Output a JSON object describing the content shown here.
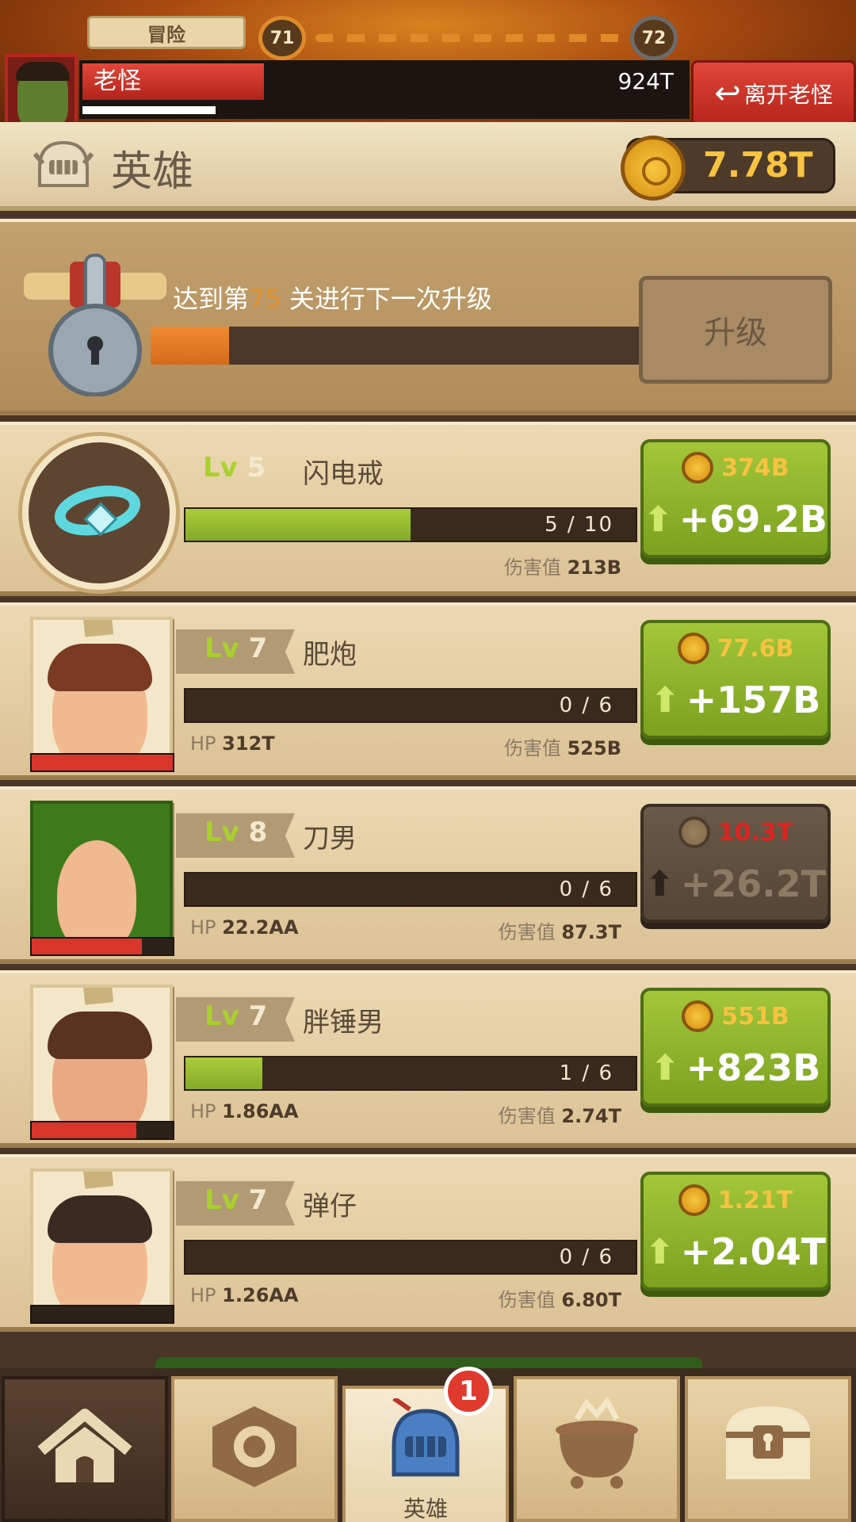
{
  "header": {
    "mode_label": "冒险",
    "current_stage": "71",
    "next_stage": "72",
    "boss_name": "老怪",
    "boss_hp": "924T",
    "boss_hp_fraction": 0.3,
    "boss_timer_fraction": 0.22,
    "leave_boss_label": "离开老怪"
  },
  "heroes_header": {
    "title": "英雄",
    "gold": "7.78T"
  },
  "upgrade": {
    "text_prefix": "达到第",
    "stage": "75",
    "text_suffix": " 关进行下一次升级",
    "progress": 0.16,
    "button_label": "升级"
  },
  "items": [
    {
      "kind": "artifact",
      "level_prefix": "Lv",
      "level": "5",
      "name": "闪电戒",
      "progress_text": "5 / 10",
      "progress": 0.5,
      "damage_label": "伤害值",
      "damage": "213B",
      "cost": "374B",
      "gain": "+69.2B",
      "affordable": true
    },
    {
      "kind": "hero",
      "level_prefix": "Lv",
      "level": "7",
      "name": "肥炮",
      "progress_text": "0 / 6",
      "progress": 0,
      "hp_label": "HP",
      "hp": "312T",
      "hp_fraction": 1.0,
      "damage_label": "伤害值",
      "damage": "525B",
      "cost": "77.6B",
      "gain": "+157B",
      "affordable": true
    },
    {
      "kind": "hero",
      "level_prefix": "Lv",
      "level": "8",
      "name": "刀男",
      "progress_text": "0 / 6",
      "progress": 0,
      "hp_label": "HP",
      "hp": "22.2AA",
      "hp_fraction": 0.78,
      "damage_label": "伤害值",
      "damage": "87.3T",
      "cost": "10.3T",
      "gain": "+26.2T",
      "affordable": false
    },
    {
      "kind": "hero",
      "level_prefix": "Lv",
      "level": "7",
      "name": "胖锤男",
      "progress_text": "1 / 6",
      "progress": 0.17,
      "hp_label": "HP",
      "hp": "1.86AA",
      "hp_fraction": 0.74,
      "damage_label": "伤害值",
      "damage": "2.74T",
      "cost": "551B",
      "gain": "+823B",
      "affordable": true
    },
    {
      "kind": "hero",
      "level_prefix": "Lv",
      "level": "7",
      "name": "弹仔",
      "progress_text": "0 / 6",
      "progress": 0,
      "hp_label": "HP",
      "hp": "1.26AA",
      "hp_fraction": 0,
      "damage_label": "伤害值",
      "damage": "6.80T",
      "cost": "1.21T",
      "gain": "+2.04T",
      "affordable": true
    }
  ],
  "nav": {
    "active_label": "英雄",
    "badge": "1",
    "items": [
      "home-icon",
      "ring-nav-icon",
      "helmet-icon",
      "cauldron-icon",
      "treasure-chest-icon"
    ]
  },
  "colors": {
    "accent_green": "#9bc236",
    "gold": "#f7c340",
    "hp_red": "#d8362b",
    "upgrade_orange": "#e6902a"
  }
}
